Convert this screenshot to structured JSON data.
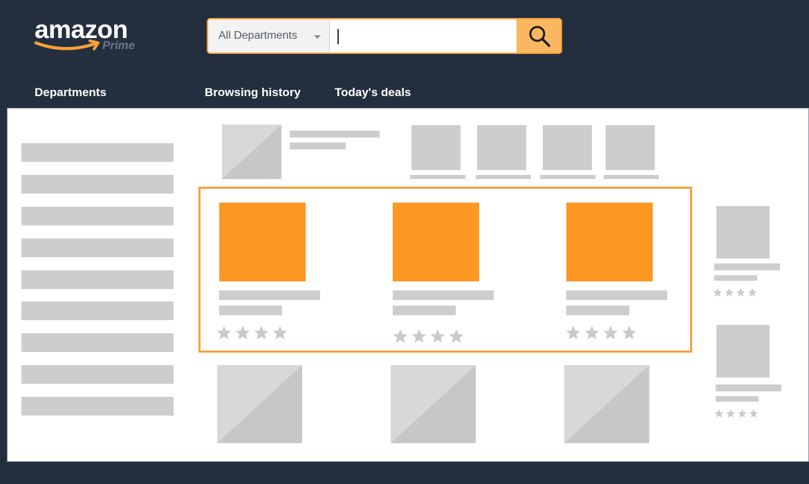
{
  "header": {
    "logo": {
      "wordmark": "amazon",
      "sub": "Prime",
      "smile_color": "#f7a03b"
    },
    "search": {
      "department_label": "All Departments",
      "query": "",
      "button_icon": "search-icon",
      "accent": "#f0a23a"
    },
    "nav": {
      "departments": "Departments",
      "browsing_history": "Browsing history",
      "todays_deals": "Today's deals"
    }
  },
  "colors": {
    "background": "#232f3e",
    "placeholder": "#cccdcf",
    "highlight_border": "#f7a03b",
    "highlight_fill": "#fd9922"
  },
  "featured_products": {
    "count": 3,
    "star_rating": 4
  },
  "side_products": {
    "count": 2,
    "star_rating": 4
  }
}
